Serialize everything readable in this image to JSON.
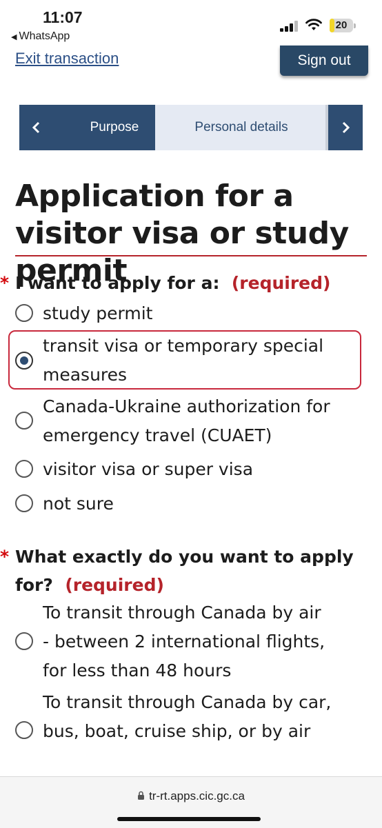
{
  "status_bar": {
    "time": "11:07",
    "back_app": "WhatsApp",
    "battery": "20"
  },
  "header": {
    "exit_link": "Exit transaction",
    "sign_out": "Sign out"
  },
  "progress": {
    "prev_icon": "chevron-left-icon",
    "tab1": "Purpose",
    "tab2": "Personal details",
    "next_icon": "chevron-right-icon"
  },
  "page_title": "Application for a visitor visa or study permit",
  "q1": {
    "star": "*",
    "label": "I want to apply for a:",
    "required": "(required)",
    "options": [
      {
        "text": "study permit",
        "checked": false
      },
      {
        "text": "transit visa or temporary special measures",
        "checked": true
      },
      {
        "text": "Canada-Ukraine authorization for emergency travel (CUAET)",
        "checked": false
      },
      {
        "text": "visitor visa or super visa",
        "checked": false
      },
      {
        "text": "not sure",
        "checked": false
      }
    ]
  },
  "q2": {
    "star": "*",
    "label": "What exactly do you want to apply for?",
    "required": "(required)",
    "options": [
      {
        "text": "To transit through Canada by air - between 2 international flights, for less than 48 hours",
        "checked": false
      },
      {
        "text": "To transit through Canada by car, bus, boat, cruise ship, or by air",
        "checked": false
      }
    ]
  },
  "url_bar": {
    "url": "tr-rt.apps.cic.gc.ca"
  },
  "colors": {
    "navy": "#2e4d72",
    "required_red": "#b5232a",
    "link_blue": "#2b4f86"
  }
}
